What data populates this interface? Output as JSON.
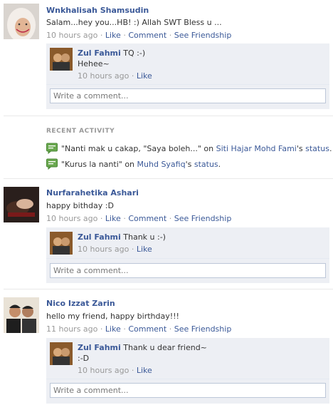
{
  "stories": [
    {
      "author": "Wnkhalisah Shamsudin",
      "message": "Salam...hey you...HB! :) Allah SWT Bless u ...",
      "time": "10 hours ago",
      "actions": [
        "Like",
        "Comment",
        "See Friendship"
      ],
      "reply": {
        "author": "Zul Fahmi",
        "text": "TQ :-)",
        "extra": "Hehee~",
        "time": "10 hours ago",
        "like": "Like"
      },
      "comment_placeholder": "Write a comment..."
    },
    {
      "author": "Nurfarahetika Ashari",
      "message": "happy bithday :D",
      "time": "10 hours ago",
      "actions": [
        "Like",
        "Comment",
        "See Friendship"
      ],
      "reply": {
        "author": "Zul Fahmi",
        "text": "Thank u :-)",
        "time": "10 hours ago",
        "like": "Like"
      },
      "comment_placeholder": "Write a comment..."
    },
    {
      "author": "Nico Izzat Zarin",
      "message": "hello my friend, happy birthday!!!",
      "time": "11 hours ago",
      "actions": [
        "Like",
        "Comment",
        "See Friendship"
      ],
      "reply": {
        "author": "Zul Fahmi",
        "text": "Thank u dear friend~",
        "extra": ":-D",
        "time": "10 hours ago",
        "like": "Like"
      },
      "comment_placeholder": "Write a comment..."
    }
  ],
  "recent_activity": {
    "heading": "RECENT ACTIVITY",
    "items": [
      {
        "quote": "\"Nanti mak u cakap, \"Saya boleh...\" on ",
        "link1": "Siti Hajar Mohd Fami",
        "sep": "'s ",
        "link2": "status",
        "end": "."
      },
      {
        "quote": "\"Kurus la nanti\" on ",
        "link1": "Muhd Syafiq",
        "sep": "'s ",
        "link2": "status",
        "end": "."
      }
    ]
  },
  "colors": {
    "link": "#3b5998",
    "muted": "#999999",
    "comment_bg": "#edeff4"
  }
}
